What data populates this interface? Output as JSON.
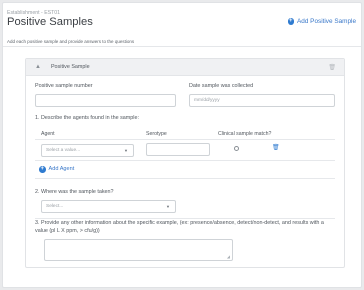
{
  "header": {
    "breadcrumb": "Establishment - EST01",
    "title": "Positive Samples",
    "add_button_label": "Add Positive Sample",
    "instructions": "Add each positive sample and provide answers to the questions"
  },
  "panel": {
    "title": "Positive Sample",
    "fields": {
      "sample_number_label": "Positive sample number",
      "sample_number_value": "",
      "date_label": "Date sample was collected",
      "date_placeholder": "mm/dd/yyyy"
    },
    "q1": {
      "label": "1. Describe the agents found in the sample:",
      "columns": [
        "Agent",
        "Serotype",
        "Clinical sample match?"
      ],
      "agent_placeholder": "Select a value...",
      "serotype_value": "",
      "clinical_match_checked": false,
      "add_agent_label": "Add Agent"
    },
    "q2": {
      "label": "2. Where was the sample taken?",
      "placeholder": "Select..."
    },
    "q3": {
      "label": "3. Provide any other information about the specific example, (ex: presence/absence, detect/non-detect, and results with a value (pl L X ppm, > cfu/g))",
      "value": ""
    }
  },
  "icons": {
    "add": "plus-circle-icon",
    "collapse": "caret-up-icon",
    "delete": "trash-icon",
    "dropdown": "chevron-down-icon"
  },
  "colors": {
    "accent": "#2f7bd0",
    "panel_header": "#f0f1f3",
    "border": "#cfd3d7"
  }
}
